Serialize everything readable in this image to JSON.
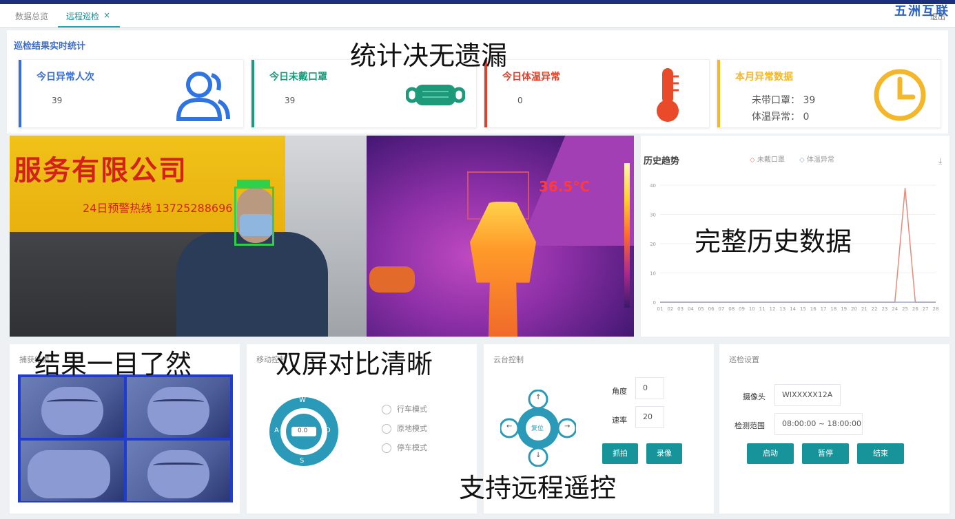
{
  "tabs": [
    "数据总览",
    "远程巡检"
  ],
  "tab_right": "退出",
  "brand_corner": "五洲互联",
  "stats": {
    "section_title": "巡检结果实时统计",
    "cards": [
      {
        "title": "今日异常人次",
        "value": "39",
        "accent": "#3a6fd8",
        "icon": "users-icon"
      },
      {
        "title": "今日未戴口罩",
        "value": "39",
        "accent": "#1d9a7a",
        "icon": "mask-icon"
      },
      {
        "title": "今日体温异常",
        "value": "0",
        "accent": "#e0402a",
        "icon": "thermometer-icon"
      },
      {
        "title": "本月异常数据",
        "accent": "#f5b72a",
        "icon": "clock-icon",
        "lines": [
          {
            "label": "未带口罩：",
            "value": "39"
          },
          {
            "label": "体温异常：",
            "value": "0"
          }
        ]
      }
    ]
  },
  "captions": {
    "stats": "统计决无遗漏",
    "history": "完整历史数据",
    "results": "结果一目了然",
    "dual": "双屏对比清晰",
    "remote": "支持远程遥控"
  },
  "video": {
    "sign_title": "服务有限公司",
    "sign_sub": "24日预警热线  13725288696",
    "thermal_text": "36.5°C"
  },
  "history": {
    "title": "历史趋势",
    "legend": [
      "未戴口罩",
      "体温异常"
    ]
  },
  "chart_data": {
    "type": "line",
    "x": [
      "01",
      "02",
      "03",
      "04",
      "05",
      "06",
      "07",
      "08",
      "09",
      "10",
      "11",
      "12",
      "13",
      "14",
      "15",
      "16",
      "17",
      "18",
      "19",
      "20",
      "21",
      "22",
      "23",
      "24",
      "25",
      "26",
      "27",
      "28"
    ],
    "series": [
      {
        "name": "未戴口罩",
        "values": [
          0,
          0,
          0,
          0,
          0,
          0,
          0,
          0,
          0,
          0,
          0,
          0,
          0,
          0,
          0,
          0,
          0,
          0,
          0,
          0,
          0,
          0,
          0,
          0,
          39,
          0,
          0,
          0
        ]
      },
      {
        "name": "体温异常",
        "values": [
          0,
          0,
          0,
          0,
          0,
          0,
          0,
          0,
          0,
          0,
          0,
          0,
          0,
          0,
          0,
          0,
          0,
          0,
          0,
          0,
          0,
          0,
          0,
          0,
          0,
          0,
          0,
          0
        ]
      }
    ],
    "ylim": [
      0,
      40
    ],
    "yticks": [
      "0",
      "10",
      "20",
      "30",
      "40"
    ],
    "colors": [
      "#e88a7a",
      "#9aaac8"
    ]
  },
  "panels": {
    "capture": {
      "title": "捕获结果"
    },
    "mode": {
      "title": "移动控制",
      "joystick": {
        "up": "W",
        "left": "A",
        "right": "D",
        "down": "S",
        "center": "0.0"
      },
      "options": [
        "行车模式",
        "原地模式",
        "停车模式"
      ]
    },
    "cloud": {
      "title": "云台控制",
      "pad": {
        "up": "↑",
        "left": "←",
        "right": "→",
        "down": "↓",
        "center": "复位"
      },
      "fields": [
        {
          "label": "角度",
          "value": "0"
        },
        {
          "label": "速率",
          "value": "20"
        }
      ],
      "buttons": [
        "抓拍",
        "录像"
      ]
    },
    "patrol": {
      "title": "巡检设置",
      "fields": [
        {
          "label": "摄像头",
          "value": "WIXXXXX12A"
        },
        {
          "label": "检测范围",
          "value": "08:00:00 ~ 18:00:00"
        }
      ],
      "buttons": [
        "启动",
        "暂停",
        "结束"
      ]
    }
  }
}
